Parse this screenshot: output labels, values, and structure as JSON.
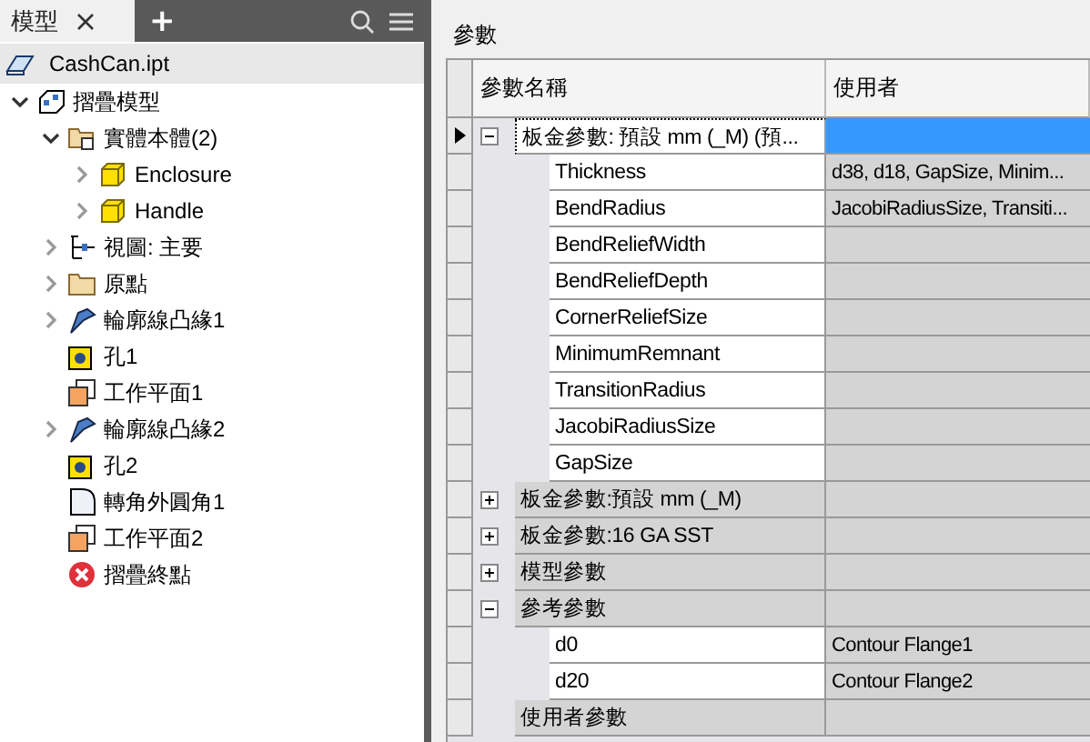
{
  "browser": {
    "tabs": [
      {
        "label": "模型",
        "selected": true
      }
    ],
    "add_label": "+"
  },
  "tree": {
    "root": {
      "label": "CashCan.ipt",
      "kind": "part"
    },
    "items": [
      {
        "label": "摺疊模型",
        "kind": "sheet-metal",
        "expanded": true,
        "children": [
          {
            "label": "實體本體(2)",
            "kind": "solid-folder",
            "expanded": true,
            "children": [
              {
                "label": "Enclosure",
                "kind": "body",
                "expanded": false
              },
              {
                "label": "Handle",
                "kind": "body",
                "expanded": false
              }
            ]
          },
          {
            "label": "視圖: 主要",
            "kind": "view",
            "expanded": false
          },
          {
            "label": "原點",
            "kind": "folder",
            "expanded": false
          },
          {
            "label": "輪廓線凸緣1",
            "kind": "flange",
            "expanded": false
          },
          {
            "label": "孔1",
            "kind": "hole"
          },
          {
            "label": "工作平面1",
            "kind": "work-plane"
          },
          {
            "label": "輪廓線凸緣2",
            "kind": "flange",
            "expanded": false
          },
          {
            "label": "孔2",
            "kind": "hole"
          },
          {
            "label": "轉角外圓角1",
            "kind": "fillet"
          },
          {
            "label": "工作平面2",
            "kind": "work-plane"
          },
          {
            "label": "摺疊終點",
            "kind": "end"
          }
        ]
      }
    ]
  },
  "parameters": {
    "title": "參數",
    "columns": [
      "參數名稱",
      "使用者"
    ],
    "groups": [
      {
        "label": "板金參數: 預設 mm (_M) (預...",
        "expanded": true,
        "selected": true,
        "children": [
          {
            "name": "Thickness",
            "used_by": "d38, d18, GapSize, Minim..."
          },
          {
            "name": "BendRadius",
            "used_by": "JacobiRadiusSize, Transiti..."
          },
          {
            "name": "BendReliefWidth"
          },
          {
            "name": "BendReliefDepth"
          },
          {
            "name": "CornerReliefSize"
          },
          {
            "name": "MinimumRemnant"
          },
          {
            "name": "TransitionRadius"
          },
          {
            "name": "JacobiRadiusSize"
          },
          {
            "name": "GapSize"
          }
        ]
      },
      {
        "label": "板金參數:預設 mm (_M)",
        "expanded": false,
        "selected": false
      },
      {
        "label": "板金參數:16 GA SST",
        "expanded": false,
        "selected": false
      },
      {
        "label": "模型參數",
        "expanded": false,
        "selected": false
      },
      {
        "label": "參考參數",
        "expanded": true,
        "selected": false,
        "children": [
          {
            "name": "d0",
            "used_by": "Contour Flange1"
          },
          {
            "name": "d20",
            "used_by": "Contour Flange2"
          }
        ]
      },
      {
        "label": "使用者參數",
        "selected": false
      }
    ]
  }
}
